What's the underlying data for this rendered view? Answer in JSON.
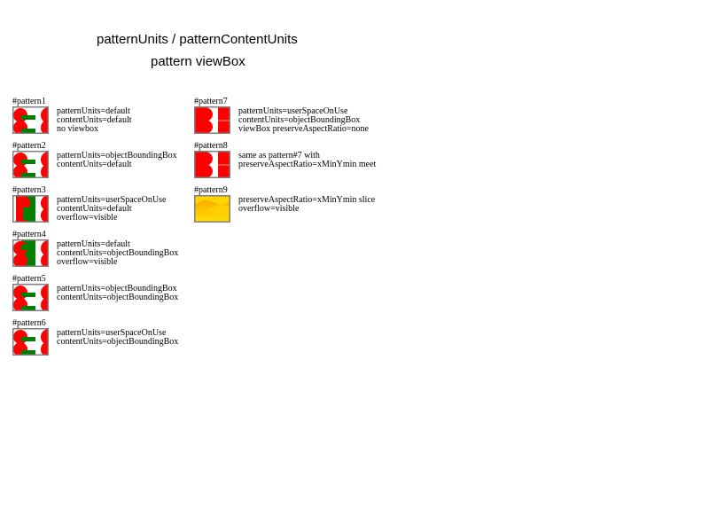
{
  "titles": [
    "patternUnits / patternContentUnits",
    "pattern viewBox"
  ],
  "items": [
    {
      "id": "#pattern1",
      "style": "a",
      "lines": [
        "patternUnits=default",
        "contentUnits=default",
        "no viewbox"
      ]
    },
    {
      "id": "#pattern2",
      "style": "a",
      "lines": [
        "patternUnits=objectBoundingBox",
        "contentUnits=default"
      ]
    },
    {
      "id": "#pattern3",
      "style": "b",
      "lines": [
        "patternUnits=userSpaceOnUse",
        "contentUnits=default",
        "overflow=visible"
      ]
    },
    {
      "id": "#pattern4",
      "style": "c",
      "lines": [
        "patternUnits=default",
        "contentUnits=objectBoundingBox",
        "overflow=visible"
      ]
    },
    {
      "id": "#pattern5",
      "style": "a",
      "lines": [
        "patternUnits=objectBoundingBox",
        "contentUnits=objectBoundingBox"
      ]
    },
    {
      "id": "#pattern6",
      "style": "a",
      "lines": [
        "patternUnits=userSpaceOnUse",
        "contentUnits=objectBoundingBox"
      ]
    },
    {
      "id": "#pattern7",
      "style": "d",
      "lines": [
        "patternUnits=userSpaceOnUse",
        "contentUnits=objectBoundingBox",
        "viewBox preserveAspectRatio=none"
      ]
    },
    {
      "id": "#pattern8",
      "style": "d",
      "lines": [
        "same as pattern#7 with",
        "preserveAspectRatio=xMinYmin meet"
      ]
    },
    {
      "id": "#pattern9",
      "style": "e",
      "lines": [
        "preserveAspectRatio=xMinYmin slice",
        "overflow=visible"
      ]
    }
  ],
  "colors": {
    "red": "#ff0000",
    "green": "#008000",
    "border": "#808080",
    "yellow": "#ffe000",
    "orange": "#ffa000"
  }
}
